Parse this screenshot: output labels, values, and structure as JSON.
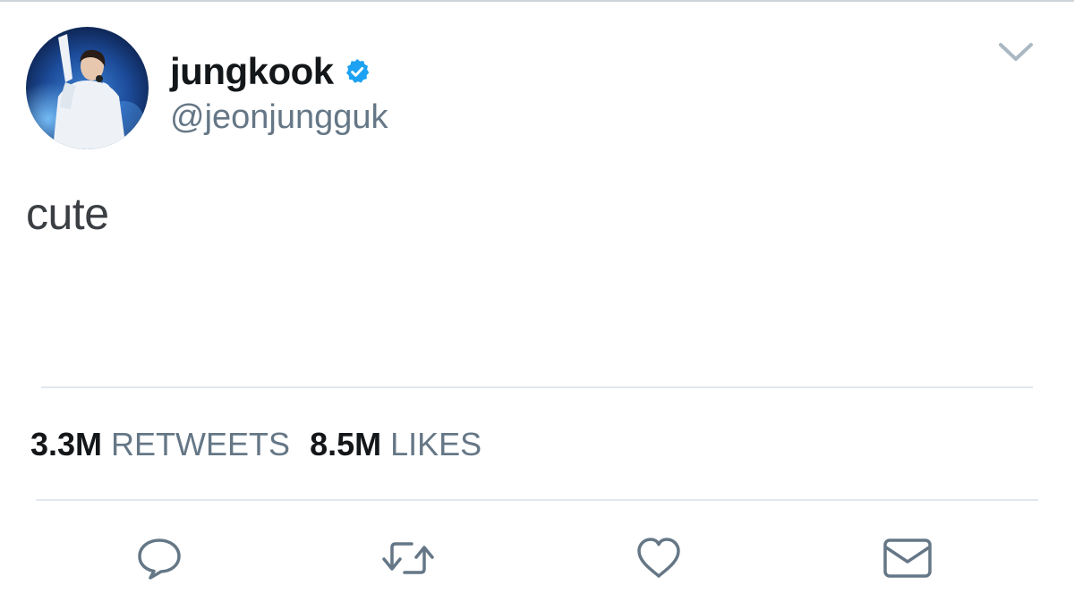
{
  "tweet": {
    "author": {
      "display_name": "jungkook",
      "handle": "@jeonjungguk",
      "verified": true,
      "avatar": "performer-avatar-photo"
    },
    "text": "cute",
    "stats": {
      "retweets_count": "3.3M",
      "retweets_label": "RETWEETS",
      "likes_count": "8.5M",
      "likes_label": "LIKES"
    },
    "actions": [
      {
        "name": "reply",
        "icon": "speech-bubble-icon"
      },
      {
        "name": "retweet",
        "icon": "retweet-arrows-icon"
      },
      {
        "name": "like",
        "icon": "heart-icon"
      },
      {
        "name": "direct-message",
        "icon": "envelope-icon"
      }
    ]
  },
  "colors": {
    "primary_text": "#14171a",
    "secondary_text": "#657786",
    "verified_blue": "#1da1f2",
    "divider": "#e1e8ed",
    "icon_gray": "#657786"
  }
}
